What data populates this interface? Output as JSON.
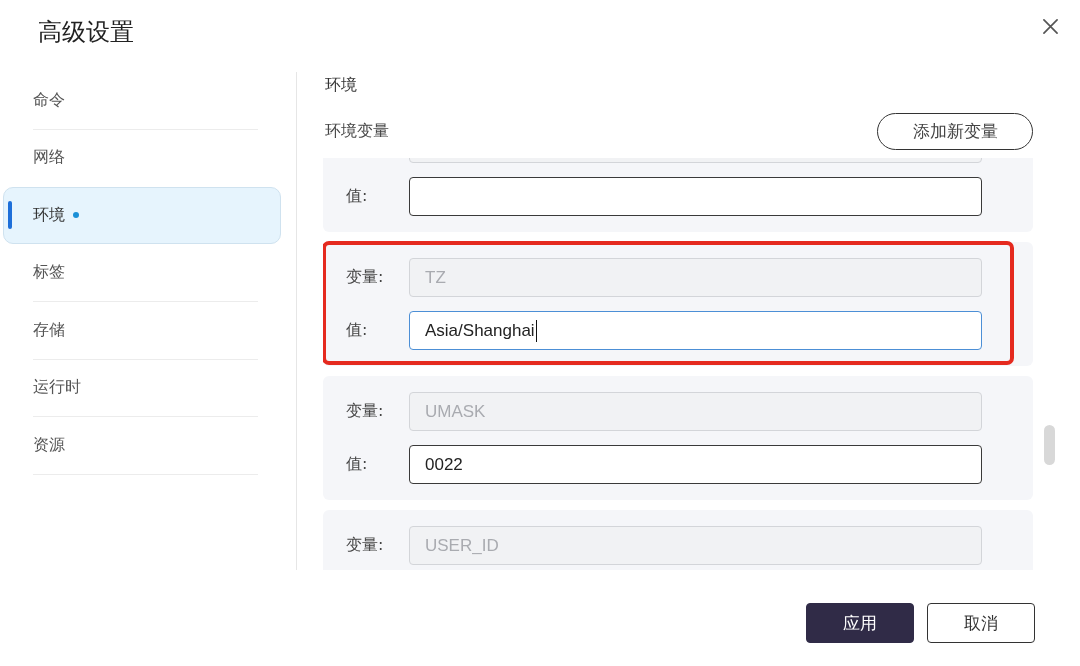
{
  "dialog": {
    "title": "高级设置"
  },
  "sidebar": {
    "items": [
      {
        "label": "命令",
        "selected": false,
        "modified": false
      },
      {
        "label": "网络",
        "selected": false,
        "modified": false
      },
      {
        "label": "环境",
        "selected": true,
        "modified": true
      },
      {
        "label": "标签",
        "selected": false,
        "modified": false
      },
      {
        "label": "存储",
        "selected": false,
        "modified": false
      },
      {
        "label": "运行时",
        "selected": false,
        "modified": false
      },
      {
        "label": "资源",
        "selected": false,
        "modified": false
      }
    ]
  },
  "section": {
    "title": "环境",
    "subtitle": "环境变量",
    "add_button": "添加新变量"
  },
  "variables": [
    {
      "highlighted": false,
      "fields": [
        {
          "disabled": true,
          "focused": false
        },
        {
          "label": "值:",
          "disabled": false,
          "focused": false
        }
      ]
    },
    {
      "highlighted": true,
      "fields": [
        {
          "label": "变量:",
          "value": "TZ",
          "disabled": true,
          "focused": false
        },
        {
          "label": "值:",
          "value": "Asia/Shanghai",
          "disabled": false,
          "focused": true
        }
      ]
    },
    {
      "highlighted": false,
      "fields": [
        {
          "label": "变量:",
          "value": "UMASK",
          "disabled": true,
          "focused": false
        },
        {
          "label": "值:",
          "value": "0022",
          "disabled": false,
          "focused": false
        }
      ]
    },
    {
      "highlighted": false,
      "fields": [
        {
          "label": "变量:",
          "value": "USER_ID",
          "disabled": true,
          "focused": false
        }
      ]
    }
  ],
  "buttons": [
    {
      "label": "应用",
      "kind": "primary"
    },
    {
      "label": "取消",
      "kind": "secondary"
    }
  ]
}
